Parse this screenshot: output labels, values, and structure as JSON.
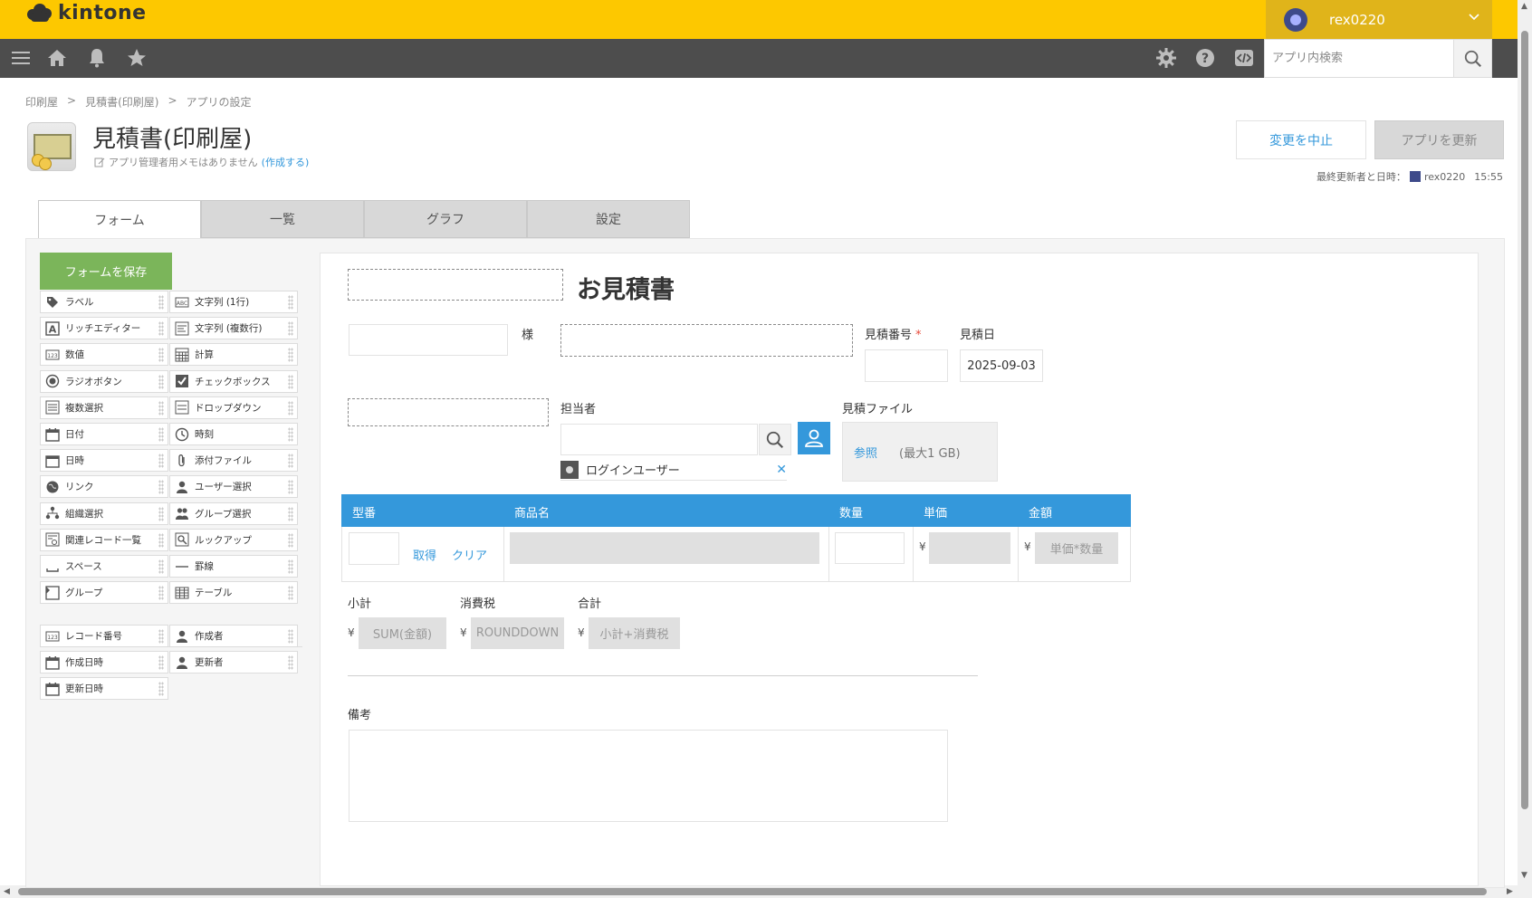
{
  "header": {
    "logo": "kintone",
    "user": "rex0220",
    "search_placeholder": "アプリ内検索"
  },
  "breadcrumb": [
    "印刷屋",
    ">",
    "見積書(印刷屋)",
    ">",
    "アプリの設定"
  ],
  "app": {
    "title": "見積書(印刷屋)",
    "memo": "アプリ管理者用メモはありません",
    "memo_link": "(作成する)",
    "cancel_label": "変更を中止",
    "update_label": "アプリを更新",
    "last_update_label": "最終更新者と日時：",
    "last_update_user": "rex0220",
    "last_update_time": "15:55"
  },
  "tabs": [
    "フォーム",
    "一覧",
    "グラフ",
    "設定"
  ],
  "palette": {
    "save_label": "フォームを保存",
    "items": [
      {
        "label": "ラベル",
        "icon": "tag-icon"
      },
      {
        "label": "文字列 (1行)",
        "icon": "abc-icon"
      },
      {
        "label": "リッチエディター",
        "icon": "rich-text-icon"
      },
      {
        "label": "文字列 (複数行)",
        "icon": "multiline-text-icon"
      },
      {
        "label": "数値",
        "icon": "number-icon"
      },
      {
        "label": "計算",
        "icon": "calculator-icon"
      },
      {
        "label": "ラジオボタン",
        "icon": "radio-icon"
      },
      {
        "label": "チェックボックス",
        "icon": "checkbox-icon"
      },
      {
        "label": "複数選択",
        "icon": "multi-select-icon"
      },
      {
        "label": "ドロップダウン",
        "icon": "dropdown-icon"
      },
      {
        "label": "日付",
        "icon": "calendar-icon"
      },
      {
        "label": "時刻",
        "icon": "clock-icon"
      },
      {
        "label": "日時",
        "icon": "datetime-icon"
      },
      {
        "label": "添付ファイル",
        "icon": "paperclip-icon"
      },
      {
        "label": "リンク",
        "icon": "globe-icon"
      },
      {
        "label": "ユーザー選択",
        "icon": "user-icon"
      },
      {
        "label": "組織選択",
        "icon": "org-icon"
      },
      {
        "label": "グループ選択",
        "icon": "group-icon"
      },
      {
        "label": "関連レコード一覧",
        "icon": "related-records-icon"
      },
      {
        "label": "ルックアップ",
        "icon": "lookup-icon"
      },
      {
        "label": "スペース",
        "icon": "space-icon"
      },
      {
        "label": "罫線",
        "icon": "line-icon"
      },
      {
        "label": "グループ",
        "icon": "group-folder-icon"
      },
      {
        "label": "テーブル",
        "icon": "table-icon"
      }
    ],
    "system_items": [
      {
        "label": "レコード番号",
        "icon": "number-icon"
      },
      {
        "label": "作成者",
        "icon": "user-icon"
      },
      {
        "label": "作成日時",
        "icon": "calendar-icon"
      },
      {
        "label": "更新者",
        "icon": "user-icon"
      },
      {
        "label": "更新日時",
        "icon": "calendar-icon"
      }
    ]
  },
  "form": {
    "title": "お見積書",
    "sama": "様",
    "estimate_no_label": "見積番号",
    "required_mark": "*",
    "estimate_date_label": "見積日",
    "estimate_date_value": "2025-09-03",
    "staff_label": "担当者",
    "login_user": "ログインユーザー",
    "file_label": "見積ファイル",
    "file_browse": "参照",
    "file_limit": "(最大1 GB)",
    "table_headers": [
      "型番",
      "商品名",
      "数量",
      "単価",
      "金額"
    ],
    "fetch_label": "取得",
    "clear_label": "クリア",
    "yen": "¥",
    "amount_formula": "単価*数量",
    "subtotal_label": "小計",
    "subtotal_formula": "SUM(金額)",
    "tax_label": "消費税",
    "tax_formula": "ROUNDDOWN",
    "total_label": "合計",
    "total_formula": "小計+消費税",
    "remarks_label": "備考"
  }
}
